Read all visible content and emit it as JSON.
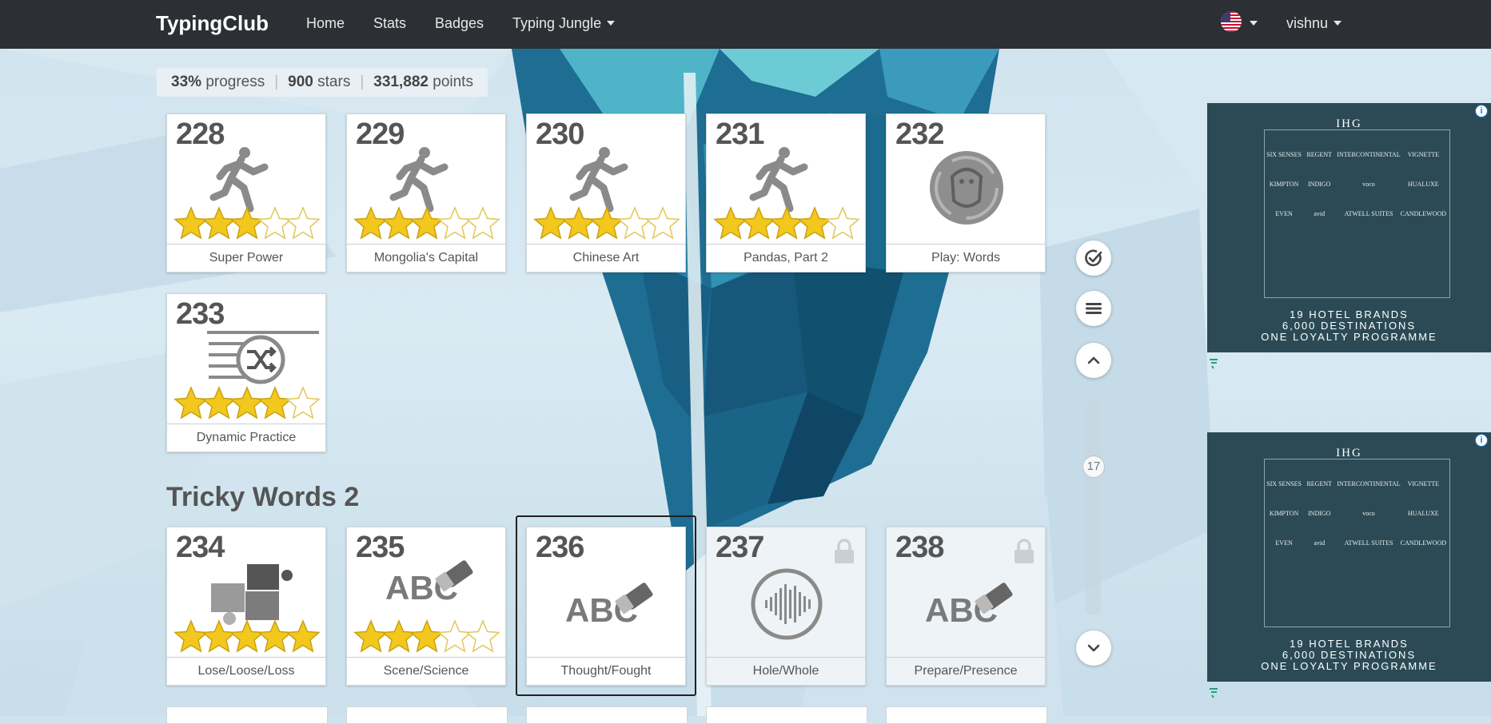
{
  "nav": {
    "brand": "TypingClub",
    "links": [
      "Home",
      "Stats",
      "Badges"
    ],
    "jungle": "Typing Jungle",
    "user": "vishnu"
  },
  "stats": {
    "progress_value": "33%",
    "progress_label": "progress",
    "stars_value": "900",
    "stars_label": "stars",
    "points_value": "331,882",
    "points_label": "points"
  },
  "lessons": [
    {
      "num": "228",
      "label": "Super Power",
      "icon": "runner-icon",
      "stars": 3,
      "locked": false
    },
    {
      "num": "229",
      "label": "Mongolia's Capital",
      "icon": "runner-icon",
      "stars": 3,
      "locked": false
    },
    {
      "num": "230",
      "label": "Chinese Art",
      "icon": "runner-icon",
      "stars": 3,
      "locked": false
    },
    {
      "num": "231",
      "label": "Pandas, Part 2",
      "icon": "runner-icon",
      "stars": 4,
      "locked": false
    },
    {
      "num": "232",
      "label": "Play: Words",
      "icon": "game-creature-icon",
      "stars": 0,
      "locked": false
    },
    {
      "num": "233",
      "label": "Dynamic Practice",
      "icon": "shuffle-practice-icon",
      "stars": 4,
      "locked": false
    }
  ],
  "section": {
    "title": "Tricky Words 2",
    "lessons": [
      {
        "num": "234",
        "label": "Lose/Loose/Loss",
        "icon": "puzzle-icon",
        "stars": 5,
        "locked": false
      },
      {
        "num": "235",
        "label": "Scene/Science",
        "icon": "abc-eraser-icon",
        "stars": 3,
        "locked": false
      },
      {
        "num": "236",
        "label": "Thought/Fought",
        "icon": "abc-eraser-icon",
        "stars": 0,
        "locked": false,
        "selected": true
      },
      {
        "num": "237",
        "label": "Hole/Whole",
        "icon": "audio-wave-icon",
        "stars": 0,
        "locked": true
      },
      {
        "num": "238",
        "label": "Prepare/Presence",
        "icon": "abc-eraser-icon",
        "stars": 0,
        "locked": true
      }
    ]
  },
  "abc_text": "ABC",
  "scroll": {
    "position": "17"
  },
  "ads": [
    {
      "ihg": "IHG",
      "brands": [
        "SIX SENSES",
        "REGENT",
        "INTERCONTINENTAL",
        "VIGNETTE",
        "KIMPTON",
        "INDIGO",
        "voco",
        "HUALUXE",
        "EVEN",
        "avid",
        "ATWELL SUITES",
        "CANDLEWOOD"
      ],
      "tagline": [
        "19 HOTEL BRANDS",
        "6,000 DESTINATIONS",
        "ONE LOYALTY PROGRAMME"
      ]
    },
    {
      "ihg": "IHG",
      "brands": [
        "SIX SENSES",
        "REGENT",
        "INTERCONTINENTAL",
        "VIGNETTE",
        "KIMPTON",
        "INDIGO",
        "voco",
        "HUALUXE",
        "EVEN",
        "avid",
        "ATWELL SUITES",
        "CANDLEWOOD"
      ],
      "tagline": [
        "19 HOTEL BRANDS",
        "6,000 DESTINATIONS",
        "ONE LOYALTY PROGRAMME"
      ]
    }
  ],
  "colors": {
    "nav": "#2c2f33",
    "star": "#f3c81e",
    "ad_bg": "#2b4a55",
    "crystal": "#1e6d93"
  }
}
